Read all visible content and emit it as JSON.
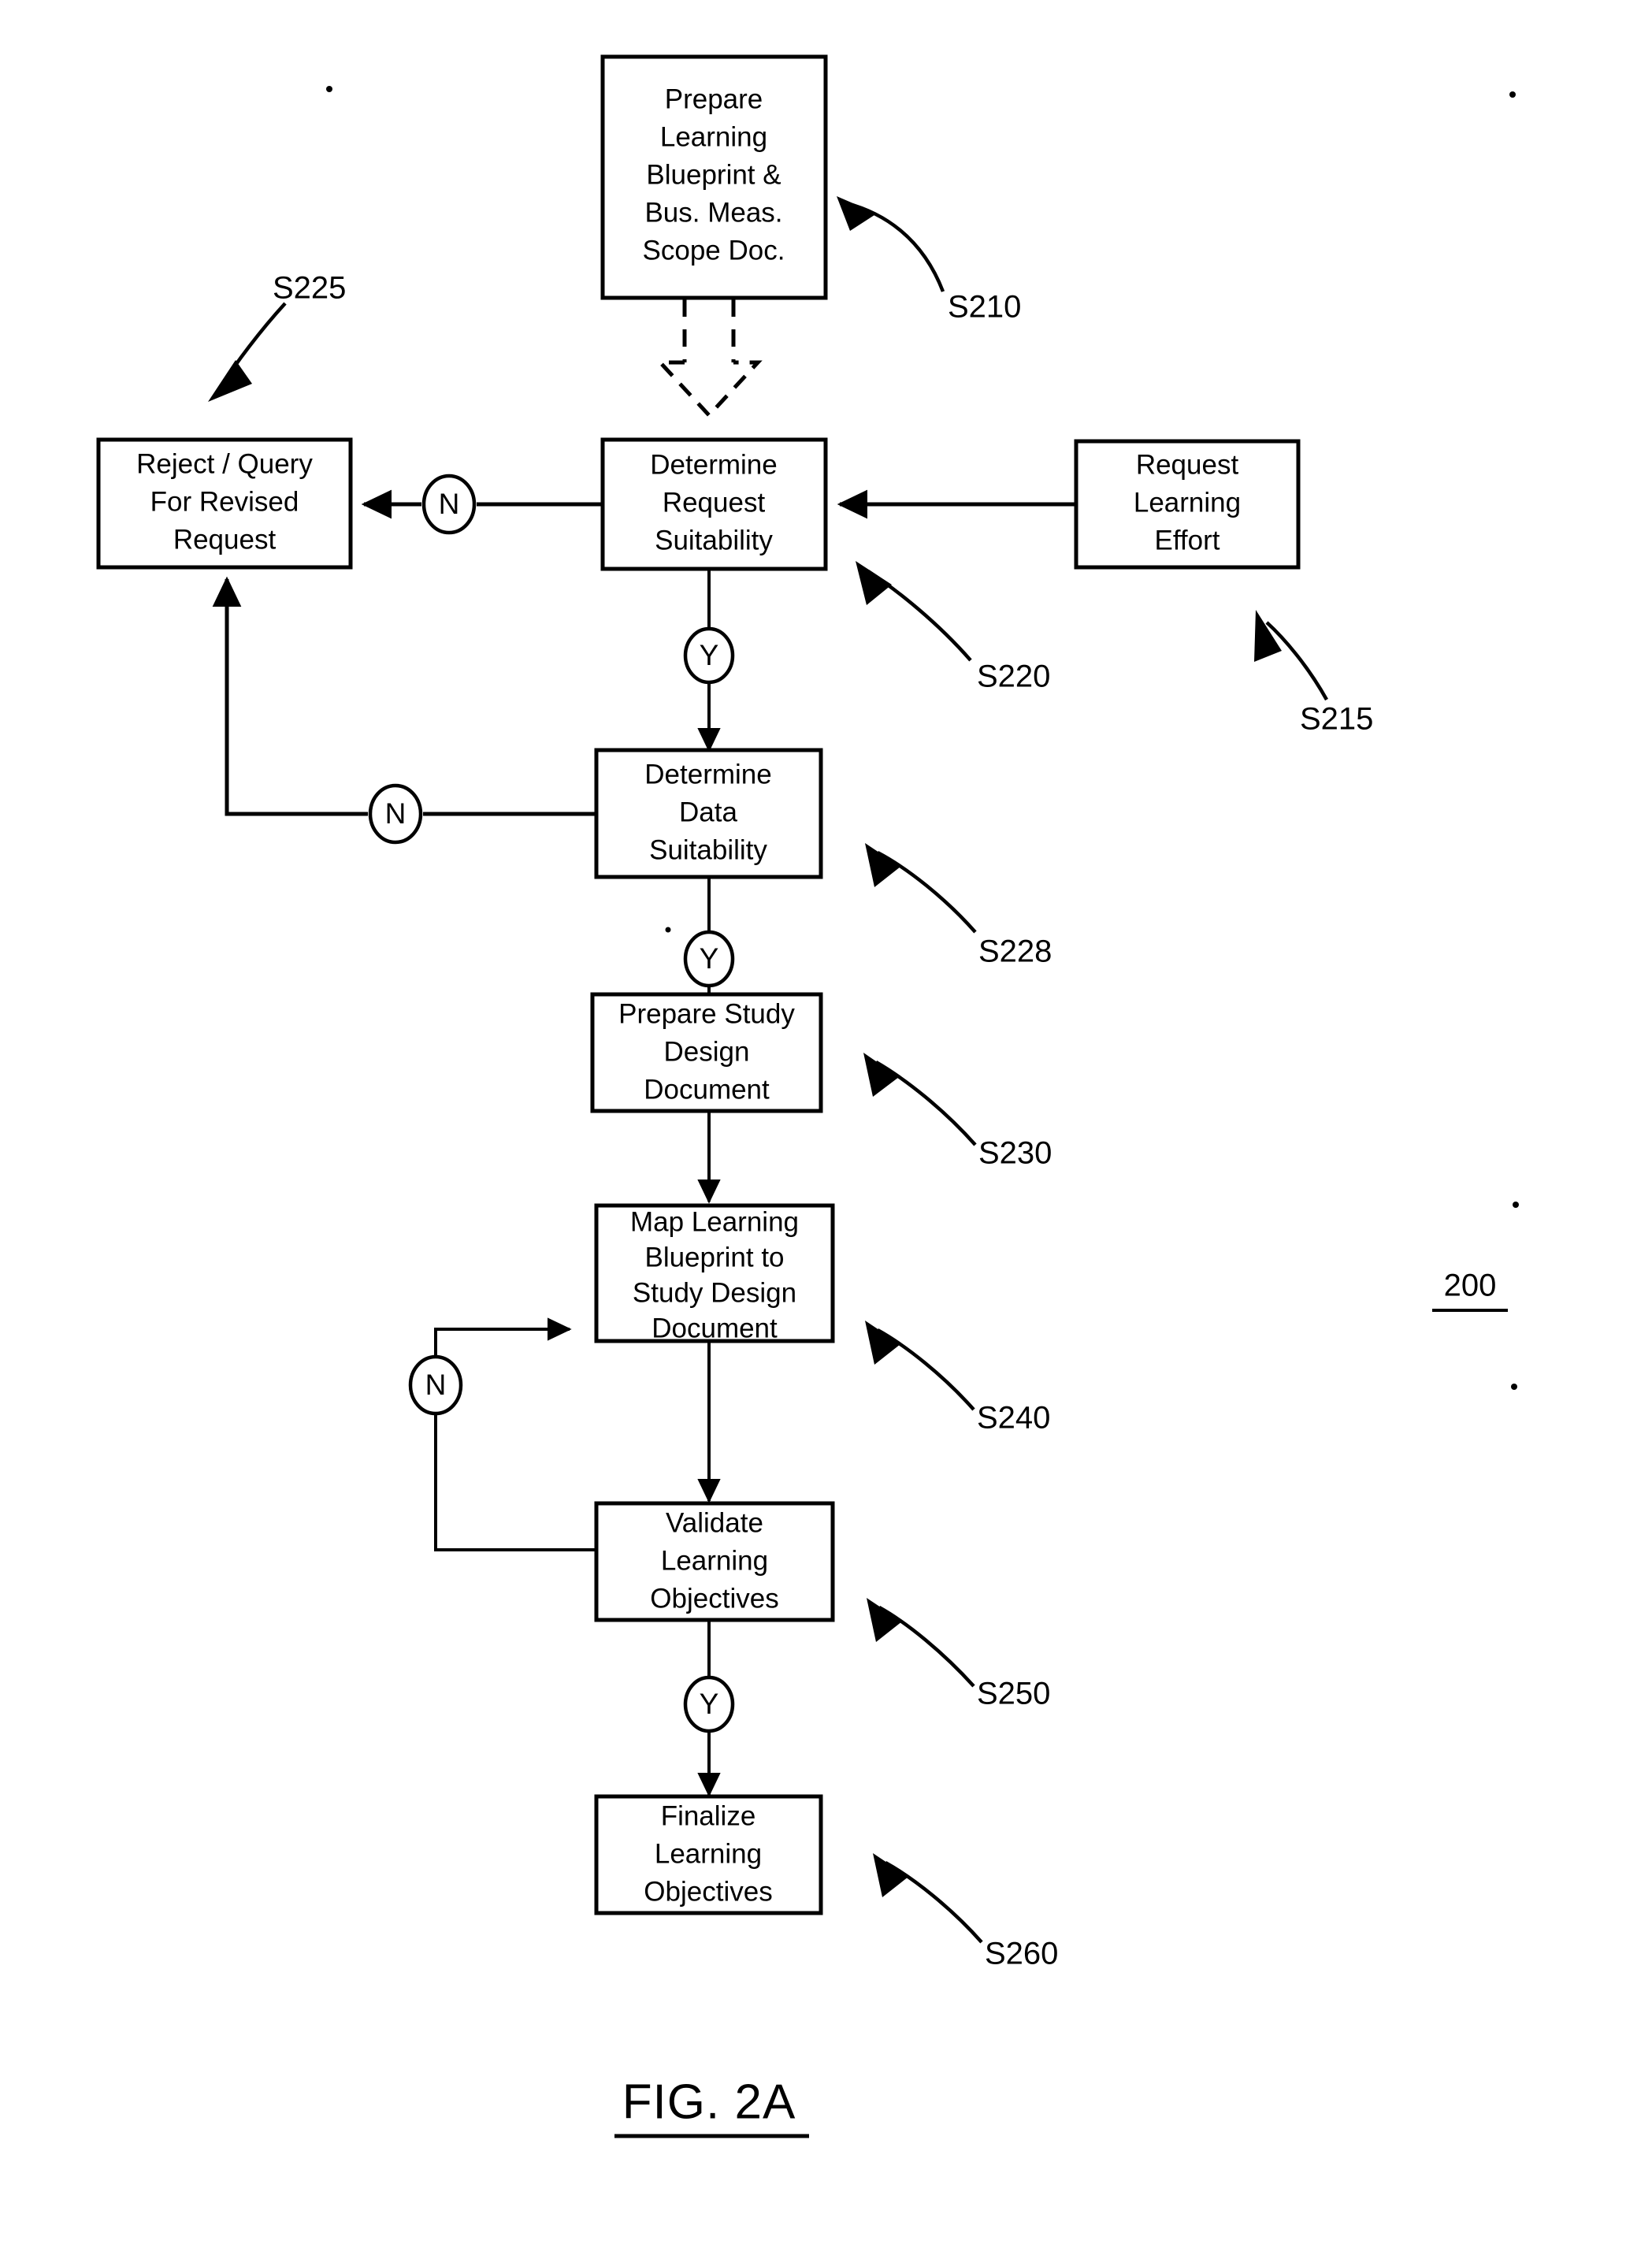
{
  "figure": {
    "caption": "FIG. 2A",
    "reference_numeral": "200"
  },
  "nodes": [
    {
      "id": "s210",
      "name": "prepare-learning-blueprint-box",
      "lines": [
        "Prepare",
        "Learning",
        "Blueprint &",
        "Bus. Meas.",
        "Scope Doc."
      ],
      "step_label": "S210"
    },
    {
      "id": "s225",
      "name": "reject-query-box",
      "lines": [
        "Reject / Query",
        "For Revised",
        "Request"
      ],
      "step_label": "S225"
    },
    {
      "id": "s220",
      "name": "determine-request-suitability-box",
      "lines": [
        "Determine",
        "Request",
        "Suitability"
      ],
      "step_label": "S220"
    },
    {
      "id": "s215",
      "name": "request-learning-effort-box",
      "lines": [
        "Request",
        "Learning",
        "Effort"
      ],
      "step_label": "S215"
    },
    {
      "id": "s228",
      "name": "determine-data-suitability-box",
      "lines": [
        "Determine",
        "Data",
        "Suitability"
      ],
      "step_label": "S228"
    },
    {
      "id": "s230",
      "name": "prepare-study-design-document-box",
      "lines": [
        "Prepare Study",
        "Design",
        "Document"
      ],
      "step_label": "S230"
    },
    {
      "id": "s240",
      "name": "map-learning-blueprint-box",
      "lines": [
        "Map Learning",
        "Blueprint to",
        "Study Design",
        "Document"
      ],
      "step_label": "S240"
    },
    {
      "id": "s250",
      "name": "validate-learning-objectives-box",
      "lines": [
        "Validate",
        "Learning",
        "Objectives"
      ],
      "step_label": "S250"
    },
    {
      "id": "s260",
      "name": "finalize-learning-objectives-box",
      "lines": [
        "Finalize",
        "Learning",
        "Objectives"
      ],
      "step_label": "S260"
    }
  ],
  "decision_markers": [
    {
      "id": "n-request",
      "label": "N",
      "from": "s220",
      "to": "s225"
    },
    {
      "id": "y-request",
      "label": "Y",
      "from": "s220",
      "to": "s228"
    },
    {
      "id": "n-data",
      "label": "N",
      "from": "s228",
      "to": "s225"
    },
    {
      "id": "y-data",
      "label": "Y",
      "from": "s228",
      "to": "s230"
    },
    {
      "id": "n-validate",
      "label": "N",
      "from": "s250",
      "to": "s240"
    },
    {
      "id": "y-validate",
      "label": "Y",
      "from": "s250",
      "to": "s260"
    }
  ],
  "box_text": {
    "s210": {
      "l0": "Prepare",
      "l1": "Learning",
      "l2": "Blueprint &",
      "l3": "Bus. Meas.",
      "l4": "Scope Doc."
    },
    "s225": {
      "l0": "Reject / Query",
      "l1": "For Revised",
      "l2": "Request"
    },
    "s220": {
      "l0": "Determine",
      "l1": "Request",
      "l2": "Suitability"
    },
    "s215": {
      "l0": "Request",
      "l1": "Learning",
      "l2": "Effort"
    },
    "s228": {
      "l0": "Determine",
      "l1": "Data",
      "l2": "Suitability"
    },
    "s230": {
      "l0": "Prepare Study",
      "l1": "Design",
      "l2": "Document"
    },
    "s240": {
      "l0": "Map Learning",
      "l1": "Blueprint to",
      "l2": "Study Design",
      "l3": "Document"
    },
    "s250": {
      "l0": "Validate",
      "l1": "Learning",
      "l2": "Objectives"
    },
    "s260": {
      "l0": "Finalize",
      "l1": "Learning",
      "l2": "Objectives"
    }
  },
  "step_labels": {
    "s210": "S210",
    "s225": "S225",
    "s220": "S220",
    "s215": "S215",
    "s228": "S228",
    "s230": "S230",
    "s240": "S240",
    "s250": "S250",
    "s260": "S260"
  },
  "markers": {
    "n_request": "N",
    "y_request": "Y",
    "n_data": "N",
    "y_data": "Y",
    "n_validate": "N",
    "y_validate": "Y"
  },
  "colors": {
    "ink": "#000000",
    "paper": "#ffffff"
  }
}
